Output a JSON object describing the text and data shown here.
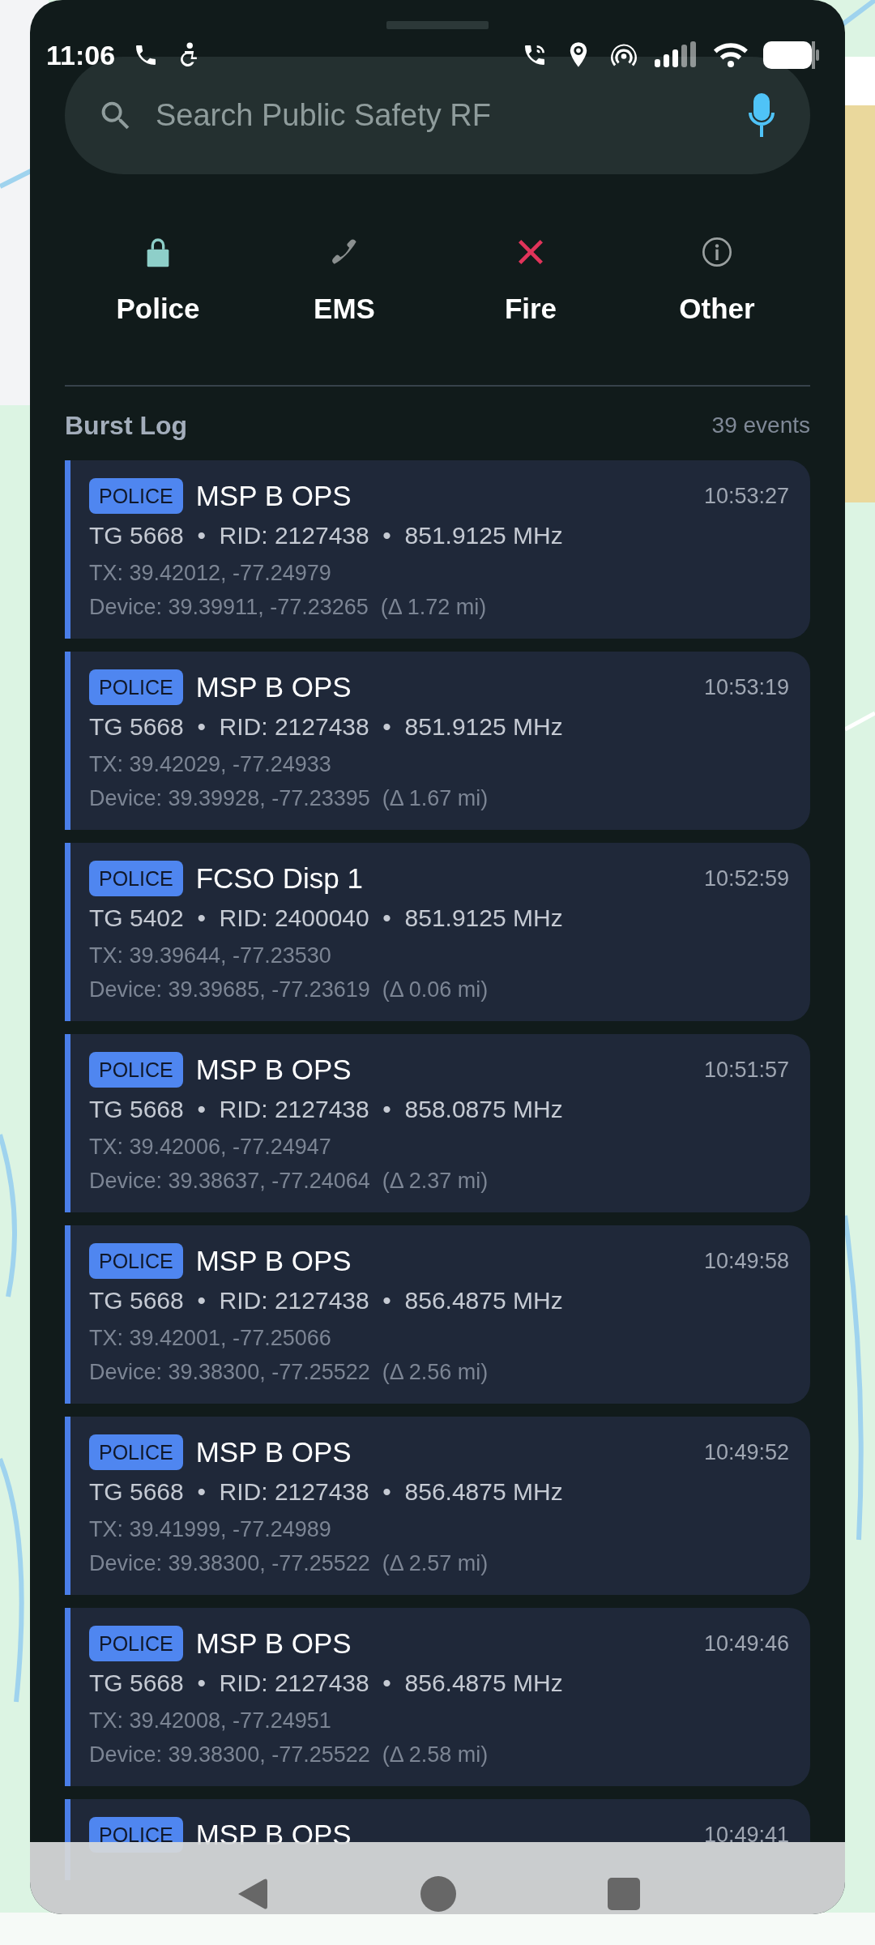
{
  "status_bar": {
    "time": "11:06"
  },
  "search": {
    "placeholder": "Search Public Safety RF"
  },
  "categories": [
    {
      "kind": "lock",
      "label": "Police",
      "color": "#8ecfc9"
    },
    {
      "kind": "phone",
      "label": "EMS",
      "color": "#8a8f8f"
    },
    {
      "kind": "cross",
      "label": "Fire",
      "color": "#e0345a"
    },
    {
      "kind": "info",
      "label": "Other",
      "color": "#9aa0a0"
    }
  ],
  "burst_log": {
    "title": "Burst Log",
    "count": "39 events",
    "events": [
      {
        "tag": "POLICE",
        "talkgroup": "MSP B OPS",
        "time": "10:53:27",
        "details": "TG 5668  •  RID: 2127438  •  851.9125 MHz",
        "tx": "TX: 39.42012, -77.24979",
        "device": "Device: 39.39911, -77.23265  (Δ 1.72 mi)"
      },
      {
        "tag": "POLICE",
        "talkgroup": "MSP B OPS",
        "time": "10:53:19",
        "details": "TG 5668  •  RID: 2127438  •  851.9125 MHz",
        "tx": "TX: 39.42029, -77.24933",
        "device": "Device: 39.39928, -77.23395  (Δ 1.67 mi)"
      },
      {
        "tag": "POLICE",
        "talkgroup": "FCSO Disp 1",
        "time": "10:52:59",
        "details": "TG 5402  •  RID: 2400040  •  851.9125 MHz",
        "tx": "TX: 39.39644, -77.23530",
        "device": "Device: 39.39685, -77.23619  (Δ 0.06 mi)"
      },
      {
        "tag": "POLICE",
        "talkgroup": "MSP B OPS",
        "time": "10:51:57",
        "details": "TG 5668  •  RID: 2127438  •  858.0875 MHz",
        "tx": "TX: 39.42006, -77.24947",
        "device": "Device: 39.38637, -77.24064  (Δ 2.37 mi)"
      },
      {
        "tag": "POLICE",
        "talkgroup": "MSP B OPS",
        "time": "10:49:58",
        "details": "TG 5668  •  RID: 2127438  •  856.4875 MHz",
        "tx": "TX: 39.42001, -77.25066",
        "device": "Device: 39.38300, -77.25522  (Δ 2.56 mi)"
      },
      {
        "tag": "POLICE",
        "talkgroup": "MSP B OPS",
        "time": "10:49:52",
        "details": "TG 5668  •  RID: 2127438  •  856.4875 MHz",
        "tx": "TX: 39.41999, -77.24989",
        "device": "Device: 39.38300, -77.25522  (Δ 2.57 mi)"
      },
      {
        "tag": "POLICE",
        "talkgroup": "MSP B OPS",
        "time": "10:49:46",
        "details": "TG 5668  •  RID: 2127438  •  856.4875 MHz",
        "tx": "TX: 39.42008, -77.24951",
        "device": "Device: 39.38300, -77.25522  (Δ 2.58 mi)"
      },
      {
        "tag": "POLICE",
        "talkgroup": "MSP B OPS",
        "time": "10:49:41"
      }
    ]
  }
}
